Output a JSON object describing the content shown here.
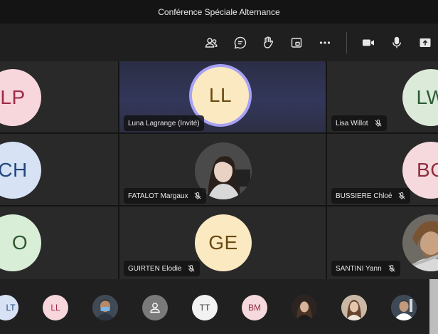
{
  "window": {
    "title": "Conférence Spéciale Alternance"
  },
  "toolbar": {
    "icons": [
      "people-icon",
      "chat-icon",
      "raise-hand-icon",
      "share-tray-icon",
      "more-icon",
      "camera-icon",
      "mic-icon",
      "share-screen-icon"
    ]
  },
  "participants": [
    {
      "initials": "LP",
      "name": ""
    },
    {
      "initials": "LL",
      "name": "Luna Lagrange (Invité)"
    },
    {
      "initials": "LW",
      "name": "Lisa Willot"
    },
    {
      "initials": "CH",
      "name": ""
    },
    {
      "initials": "",
      "name": "FATALOT Margaux"
    },
    {
      "initials": "BC",
      "name": "BUSSIERE Chloé"
    },
    {
      "initials": "O",
      "name": ""
    },
    {
      "initials": "GE",
      "name": "GUIRTEN Elodie"
    },
    {
      "initials": "",
      "name": "SANTINI Yann"
    }
  ],
  "strip": [
    {
      "initials": "LT"
    },
    {
      "initials": "LL"
    },
    {
      "initials": ""
    },
    {
      "initials": ""
    },
    {
      "initials": "TT"
    },
    {
      "initials": "BM"
    },
    {
      "initials": ""
    },
    {
      "initials": ""
    },
    {
      "initials": ""
    }
  ],
  "colors": {
    "accent_ring": "#a7a2f5",
    "ll_bg": "#fbe9c2",
    "ll_fg": "#6b4a12",
    "lp_bg": "#f7d6dc",
    "lp_fg": "#9e2b47",
    "lw_bg": "#dcebd9",
    "lw_fg": "#2c5a33",
    "ch_bg": "#d7e3f5",
    "ch_fg": "#23477d",
    "bc_bg": "#f5d9dd",
    "bc_fg": "#8e2d3e",
    "o_bg": "#d9eed7",
    "o_fg": "#2f5a31",
    "ge_bg": "#fbe9c2",
    "ge_fg": "#6b4a12"
  }
}
